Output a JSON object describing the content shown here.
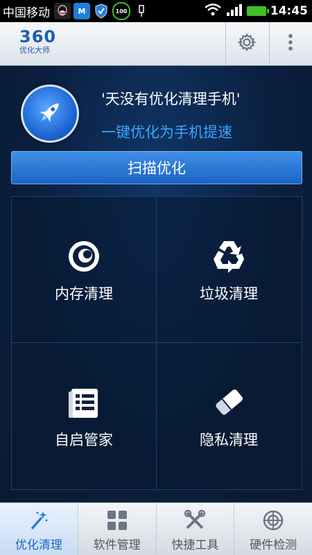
{
  "statusbar": {
    "carrier": "中国移动",
    "time": "14:45",
    "badge_text": "100"
  },
  "header": {
    "logo_number": "360",
    "logo_subtitle": "优化大师",
    "icons": [
      "gear-icon",
      "more-vert-icon"
    ]
  },
  "main": {
    "promo_text": "'天没有优化清理手机'",
    "subtitle": "一键优化为手机提速",
    "scan_button": "扫描优化",
    "tiles": [
      {
        "label": "内存清理",
        "icon": "memory-icon"
      },
      {
        "label": "垃圾清理",
        "icon": "recycle-icon"
      },
      {
        "label": "自启管家",
        "icon": "startup-list-icon"
      },
      {
        "label": "隐私清理",
        "icon": "eraser-icon"
      }
    ]
  },
  "tabs": [
    {
      "label": "优化清理",
      "icon": "magic-wand-icon",
      "active": true
    },
    {
      "label": "软件管理",
      "icon": "grid-apps-icon",
      "active": false
    },
    {
      "label": "快捷工具",
      "icon": "tools-icon",
      "active": false
    },
    {
      "label": "硬件检测",
      "icon": "hardware-check-icon",
      "active": false
    }
  ],
  "colors": {
    "accent": "#1c63c5",
    "subtitle": "#3aa6ff",
    "background": "#0b1e3a",
    "battery": "#3fbf2a"
  }
}
